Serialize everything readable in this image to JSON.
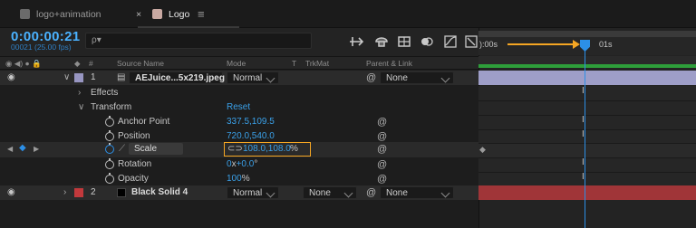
{
  "tabs": [
    {
      "label": "logo+animation",
      "active": false,
      "swatch": "#6b6b6b"
    },
    {
      "label": "Logo",
      "active": true,
      "swatch": "#c9a9a2"
    }
  ],
  "tab_close": "×",
  "tab_menu": "≡",
  "comp": {
    "timecode": "0:00:00:21",
    "frames": "00021 (25.00 fps)",
    "search_placeholder": "ρ▾"
  },
  "columns": {
    "num": "#",
    "source": "Source Name",
    "mode": "Mode",
    "t": "T",
    "trkmat": "TrkMat",
    "parent": "Parent & Link"
  },
  "layers": [
    {
      "num": "1",
      "name": "AEJuice...5x219.jpeg",
      "mode": "Normal",
      "parent": "None",
      "label_color": "#9896c2"
    },
    {
      "num": "2",
      "name": "Black Solid 4",
      "mode": "Normal",
      "trkmat": "None",
      "parent": "None",
      "label_color": "#c2393c"
    }
  ],
  "groups": {
    "effects": "Effects",
    "transform": "Transform",
    "reset": "Reset"
  },
  "properties": [
    {
      "name": "Anchor Point",
      "value": "337.5,109.5"
    },
    {
      "name": "Position",
      "value": "720.0,540.0"
    },
    {
      "name": "Scale",
      "value": "108.0,108.0",
      "unit": "%"
    },
    {
      "name": "Rotation",
      "value_a": "0",
      "value_x": "x",
      "value_b": "+0.0",
      "unit": "°"
    },
    {
      "name": "Opacity",
      "value": "100",
      "unit": "%"
    }
  ],
  "ruler": {
    "start": "):00s",
    "mark": "01s"
  },
  "colors": {
    "accent": "#2c8fe6",
    "highlight": "#f5a623",
    "layer1_bar": "#9e9ec8",
    "layer2_bar": "#a03538",
    "work_area": "#2e9e3a"
  },
  "playhead_progress": 0.5
}
